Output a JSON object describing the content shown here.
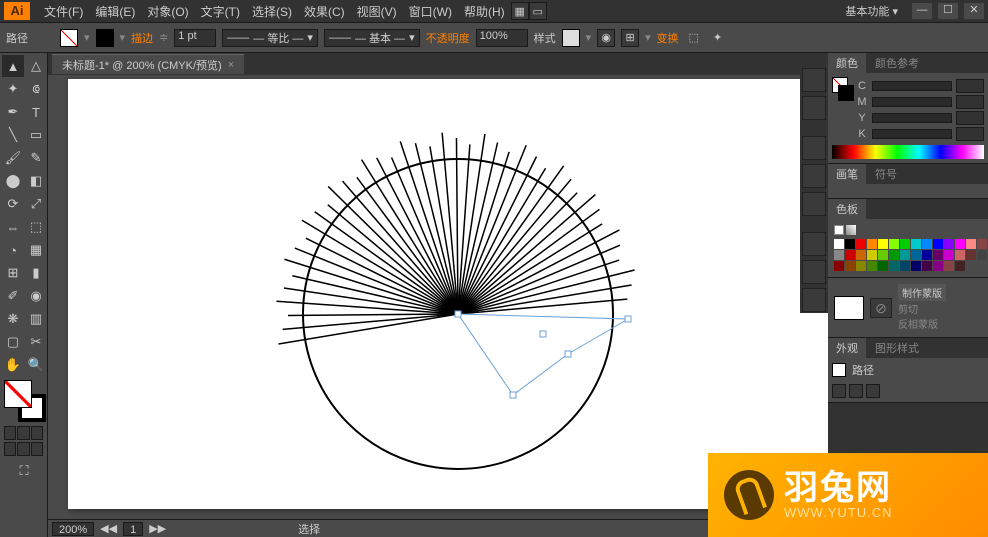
{
  "menubar": {
    "items": [
      "文件(F)",
      "编辑(E)",
      "对象(O)",
      "文字(T)",
      "选择(S)",
      "效果(C)",
      "视图(V)",
      "窗口(W)",
      "帮助(H)"
    ],
    "workspace": "基本功能"
  },
  "ctrlbar": {
    "label": "路径",
    "stroke_label": "描边",
    "stroke_weight": "1 pt",
    "profile": "— 等比 —",
    "brush": "— 基本 —",
    "opacity_label": "不透明度",
    "opacity": "100%",
    "style_label": "样式",
    "transform": "变换"
  },
  "document": {
    "tab": "未标题-1* @ 200% (CMYK/预览)"
  },
  "statusbar": {
    "zoom": "200%",
    "page": "1",
    "mode": "选择"
  },
  "panels": {
    "color": {
      "tab1": "颜色",
      "tab2": "颜色参考",
      "channels": [
        "C",
        "M",
        "Y",
        "K"
      ]
    },
    "brush": {
      "tab1": "画笔",
      "tab2": "符号"
    },
    "swatches": {
      "tab": "色板"
    },
    "mask": {
      "make": "制作蒙版",
      "clip": "剪切",
      "invert": "反相蒙版"
    },
    "appearance": {
      "tab1": "外观",
      "tab2": "图形样式",
      "item": "路径"
    }
  },
  "watermark": {
    "brand": "羽兔网",
    "url": "WWW.YUTU.CN"
  },
  "swatch_colors": [
    "#fff",
    "#000",
    "#e00",
    "#f80",
    "#ff0",
    "#8f0",
    "#0c0",
    "#0cc",
    "#08f",
    "#00f",
    "#80f",
    "#f0f",
    "#f88",
    "#844",
    "#888",
    "#c00",
    "#c60",
    "#cc0",
    "#6c0",
    "#090",
    "#099",
    "#069",
    "#009",
    "#606",
    "#c0c",
    "#c66",
    "#633",
    "#444",
    "#800",
    "#840",
    "#880",
    "#480",
    "#060",
    "#066",
    "#046",
    "#006",
    "#404",
    "#808",
    "#844",
    "#422"
  ]
}
